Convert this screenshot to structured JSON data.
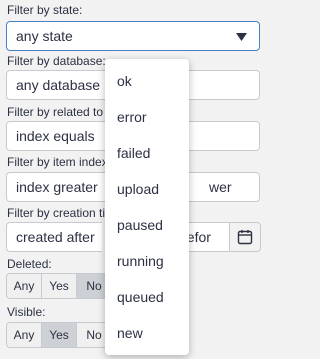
{
  "filters": {
    "state": {
      "label": "Filter by state:",
      "value": "any state"
    },
    "database": {
      "label": "Filter by database:",
      "value": "any database"
    },
    "related": {
      "label": "Filter by related to",
      "value": "index equals"
    },
    "item_index": {
      "label": "Filter by item index",
      "value": "index greater",
      "value_suffix": "wer"
    },
    "creation_time": {
      "label": "Filter by creation ti",
      "after_value": "created after",
      "before_value": "befor"
    },
    "deleted": {
      "label": "Deleted:",
      "options": [
        "Any",
        "Yes",
        "No"
      ],
      "selected": "No"
    },
    "visible": {
      "label": "Visible:",
      "options": [
        "Any",
        "Yes",
        "No"
      ],
      "selected": "Yes"
    }
  },
  "dropdown": {
    "options": [
      "ok",
      "error",
      "failed",
      "upload",
      "paused",
      "running",
      "queued",
      "new"
    ]
  },
  "icons": {
    "caret": "caret-down-icon",
    "calendar": "calendar-icon"
  }
}
